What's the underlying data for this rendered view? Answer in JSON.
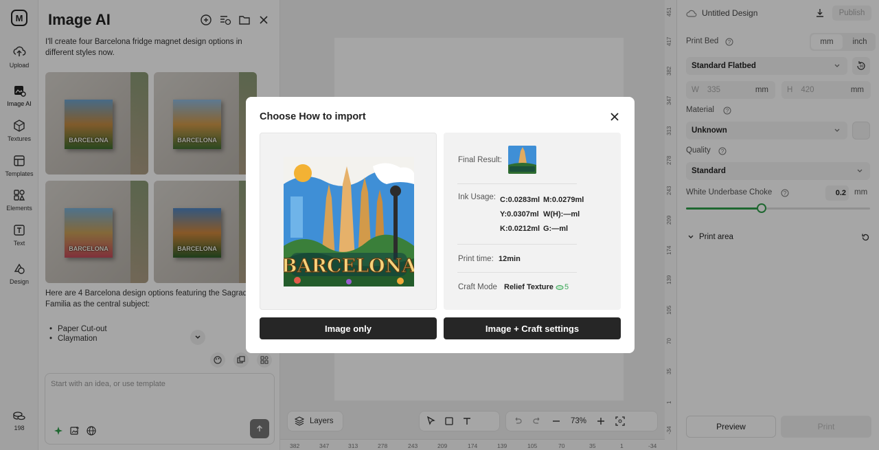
{
  "rail": {
    "items": [
      {
        "label": "Upload",
        "icon": "upload-icon"
      },
      {
        "label": "Image AI",
        "icon": "image-ai-icon"
      },
      {
        "label": "Textures",
        "icon": "textures-icon"
      },
      {
        "label": "Templates",
        "icon": "templates-icon"
      },
      {
        "label": "Elements",
        "icon": "elements-icon"
      },
      {
        "label": "Text",
        "icon": "text-icon"
      },
      {
        "label": "Design",
        "icon": "design-icon"
      }
    ],
    "credits": "198"
  },
  "image_ai": {
    "title": "Image AI",
    "intro_message": "I'll create four Barcelona fridge magnet design options in different styles now.",
    "thumb_label": "BARCELONA",
    "summary_message": "Here are 4 Barcelona design options featuring the Sagrada Familia as the central subject:",
    "style_list": [
      "Paper Cut-out",
      "Claymation"
    ],
    "prompt_placeholder": "Start with an idea, or use template"
  },
  "canvas": {
    "layers_label": "Layers",
    "zoom": "73%",
    "ruler_h": [
      "382",
      "347",
      "313",
      "278",
      "243",
      "209",
      "174",
      "139",
      "105",
      "70",
      "35",
      "1",
      "-34"
    ],
    "ruler_v": [
      "451",
      "417",
      "382",
      "347",
      "313",
      "278",
      "243",
      "209",
      "174",
      "139",
      "105",
      "70",
      "35",
      "1",
      "-34"
    ]
  },
  "props": {
    "design_title": "Untitled Design",
    "publish_label": "Publish",
    "print_bed_label": "Print Bed",
    "unit_mm": "mm",
    "unit_inch": "inch",
    "bed_value": "Standard Flatbed",
    "w_label": "W",
    "w_value": "335",
    "h_label": "H",
    "h_value": "420",
    "dim_unit": "mm",
    "material_label": "Material",
    "material_value": "Unknown",
    "quality_label": "Quality",
    "quality_value": "Standard",
    "choke_label": "White Underbase Choke",
    "choke_value": "0.2",
    "choke_unit": "mm",
    "choke_slider_fraction": 0.41,
    "print_area_label": "Print area",
    "preview_label": "Preview",
    "print_label": "Print",
    "accent": "#2f9f4a"
  },
  "modal": {
    "title": "Choose How to import",
    "poster_text": "BARCELONA",
    "final_result_label": "Final Result:",
    "ink_usage_label": "Ink Usage:",
    "ink": {
      "c": "C:0.0283ml",
      "m": "M:0.0279ml",
      "y": "Y:0.0307ml",
      "wh": "W(H):—ml",
      "k": "K:0.0212ml",
      "g": "G:—ml"
    },
    "print_time_label": "Print time:",
    "print_time_value": "12min",
    "craft_mode_label": "Craft Mode",
    "craft_mode_value": "Relief Texture",
    "craft_mode_count": "5",
    "btn_image_only": "Image only",
    "btn_image_craft": "Image + Craft settings"
  }
}
